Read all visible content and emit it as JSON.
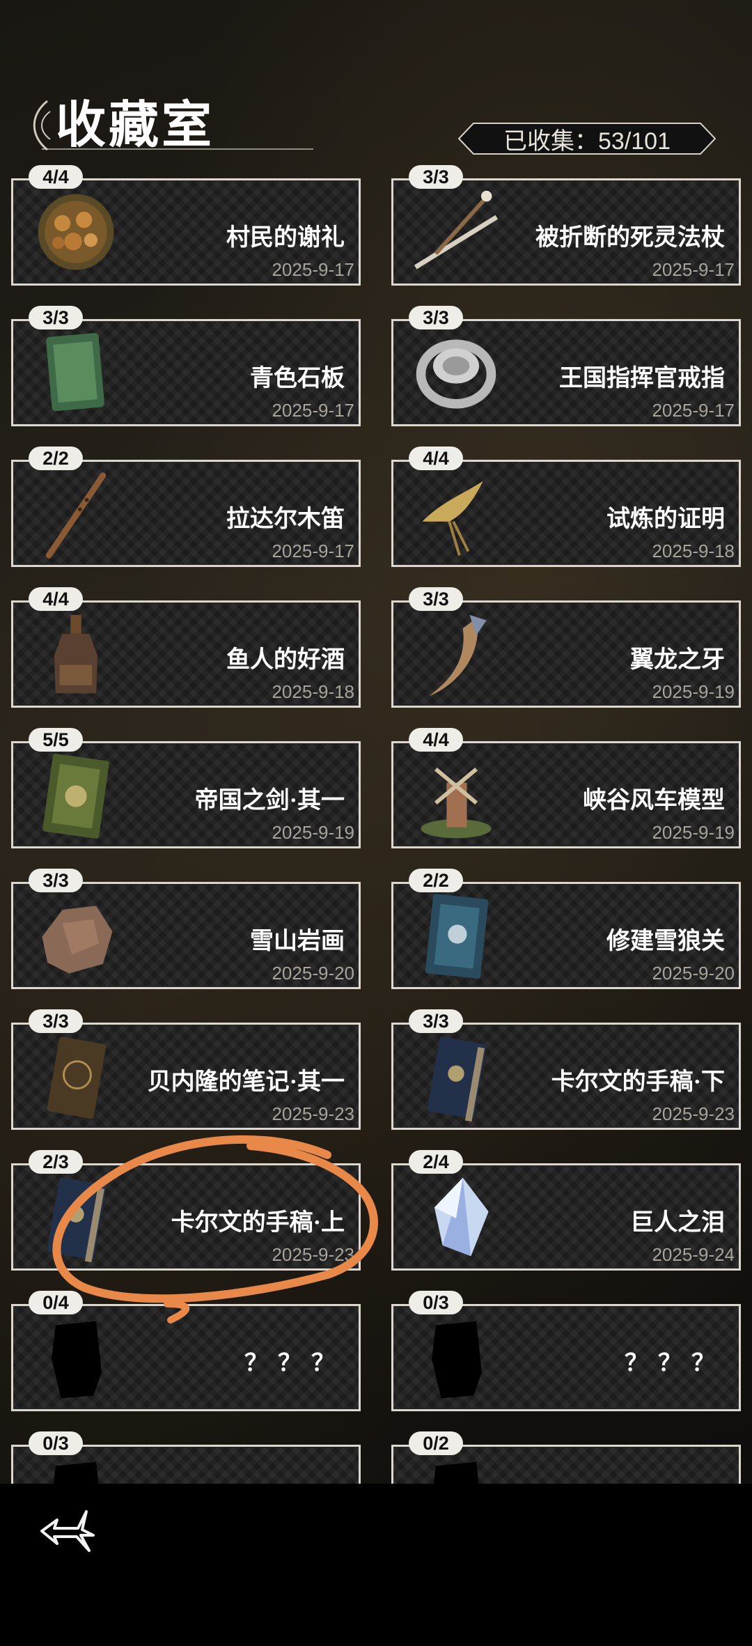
{
  "header": {
    "title": "收藏室",
    "counter": "已收集：53/101"
  },
  "items": [
    {
      "count": "4/4",
      "name": "村民的谢礼",
      "date": "2025-9-17",
      "icon": "wreath-icon"
    },
    {
      "count": "3/3",
      "name": "被折断的死灵法杖",
      "date": "2025-9-17",
      "icon": "broken-staff-icon"
    },
    {
      "count": "3/3",
      "name": "青色石板",
      "date": "2025-9-17",
      "icon": "stone-tablet-icon"
    },
    {
      "count": "3/3",
      "name": "王国指挥官戒指",
      "date": "2025-9-17",
      "icon": "ring-icon"
    },
    {
      "count": "2/2",
      "name": "拉达尔木笛",
      "date": "2025-9-17",
      "icon": "flute-icon"
    },
    {
      "count": "4/4",
      "name": "试炼的证明",
      "date": "2025-9-18",
      "icon": "feather-emblem-icon"
    },
    {
      "count": "4/4",
      "name": "鱼人的好酒",
      "date": "2025-9-18",
      "icon": "bottle-icon"
    },
    {
      "count": "3/3",
      "name": "翼龙之牙",
      "date": "2025-9-19",
      "icon": "fang-icon"
    },
    {
      "count": "5/5",
      "name": "帝国之剑·其一",
      "date": "2025-9-19",
      "icon": "green-book-icon"
    },
    {
      "count": "4/4",
      "name": "峡谷风车模型",
      "date": "2025-9-19",
      "icon": "windmill-icon"
    },
    {
      "count": "3/3",
      "name": "雪山岩画",
      "date": "2025-9-20",
      "icon": "rock-icon"
    },
    {
      "count": "2/2",
      "name": "修建雪狼关",
      "date": "2025-9-20",
      "icon": "blue-book-icon"
    },
    {
      "count": "3/3",
      "name": "贝内隆的笔记·其一",
      "date": "2025-9-23",
      "icon": "notebook-icon"
    },
    {
      "count": "3/3",
      "name": "卡尔文的手稿·下",
      "date": "2025-9-23",
      "icon": "manuscript-icon"
    },
    {
      "count": "2/3",
      "name": "卡尔文的手稿·上",
      "date": "2025-9-23",
      "icon": "manuscript-icon"
    },
    {
      "count": "2/4",
      "name": "巨人之泪",
      "date": "2025-9-24",
      "icon": "crystal-icon"
    },
    {
      "count": "0/4",
      "name": "？？？",
      "date": "",
      "icon": "unknown-silhouette-icon"
    },
    {
      "count": "0/3",
      "name": "？？？",
      "date": "",
      "icon": "unknown-silhouette-icon"
    },
    {
      "count": "0/3",
      "name": "",
      "date": "",
      "icon": "unknown-silhouette-icon"
    },
    {
      "count": "0/2",
      "name": "",
      "date": "",
      "icon": "unknown-silhouette-icon"
    }
  ],
  "footer": {
    "back_icon": "back-emblem-icon"
  },
  "annotation": {
    "color": "#e8894a",
    "shape": "hand-drawn-circle"
  }
}
